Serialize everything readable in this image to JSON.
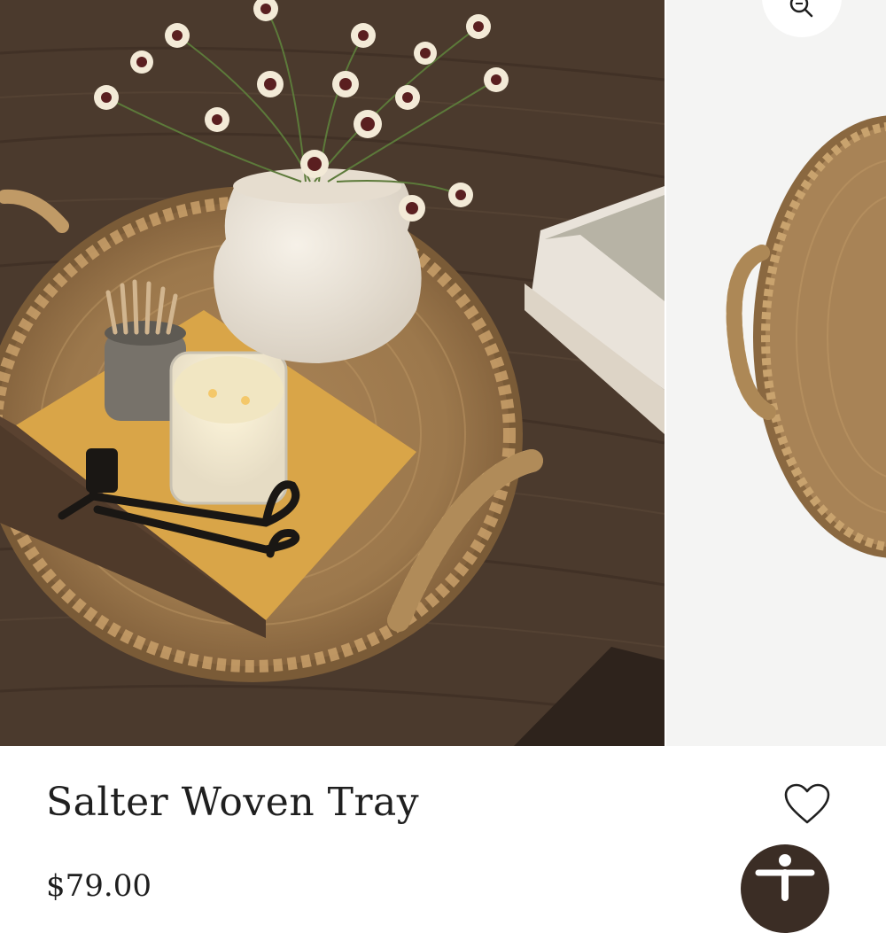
{
  "product": {
    "title": "Salter Woven Tray",
    "price": "$79.00"
  },
  "gallery": {
    "images": [
      {
        "icon": "styled-tray-photo"
      },
      {
        "icon": "tray-product-photo"
      }
    ],
    "zoom_icon": "magnifier-icon"
  },
  "actions": {
    "wishlist_icon": "heart-outline-icon",
    "accessibility_icon": "accessibility-person-icon"
  },
  "colors": {
    "text": "#1f1f1f",
    "accessibility_bg": "#3b2d25",
    "table_wood": "#4a3a2e",
    "woven_tan": "#b08a58",
    "book_yellow": "#d9a548"
  }
}
